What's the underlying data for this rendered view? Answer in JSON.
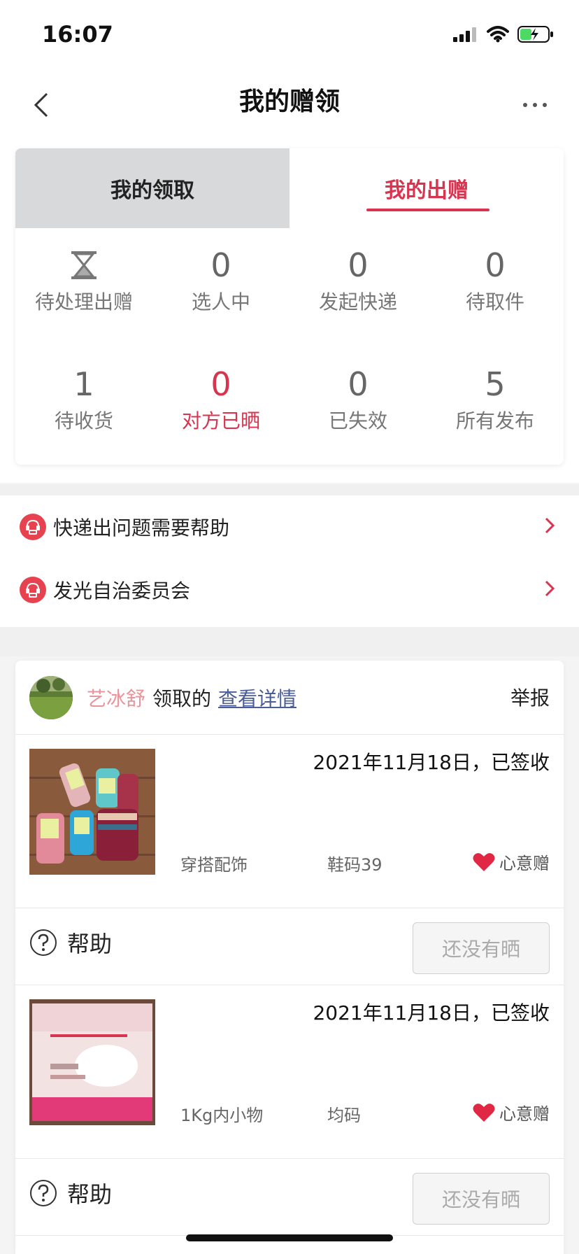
{
  "status_bar": {
    "time": "16:07"
  },
  "nav": {
    "title": "我的赠领"
  },
  "tabs": [
    {
      "label": "我的领取",
      "active": false
    },
    {
      "label": "我的出赠",
      "active": true
    }
  ],
  "stats": [
    {
      "value": "",
      "label": "待处理出赠",
      "icon": "hourglass-icon"
    },
    {
      "value": "0",
      "label": "选人中"
    },
    {
      "value": "0",
      "label": "发起快递"
    },
    {
      "value": "0",
      "label": "待取件"
    },
    {
      "value": "1",
      "label": "待收货"
    },
    {
      "value": "0",
      "label": "对方已晒",
      "highlight": true
    },
    {
      "value": "0",
      "label": "已失效"
    },
    {
      "value": "5",
      "label": "所有发布"
    }
  ],
  "help_links": [
    {
      "label": "快递出问题需要帮助"
    },
    {
      "label": "发光自治委员会"
    }
  ],
  "claim": {
    "claimer": "艺冰舒",
    "verb": "领取的",
    "detail_link": "查看详情",
    "report": "举报",
    "items": [
      {
        "date": "2021年11月18日，已签收",
        "category": "穿搭配饰",
        "size": "鞋码39",
        "tag": "心意赠",
        "help": "帮助",
        "status_button": "还没有晒"
      },
      {
        "date": "2021年11月18日，已签收",
        "category": "1Kg内小物",
        "size": "均码",
        "tag": "心意赠",
        "help": "帮助",
        "status_button": "还没有晒"
      }
    ]
  },
  "colors": {
    "accent": "#d9344f",
    "link": "#4a5d99",
    "claimer": "#e9949a"
  }
}
